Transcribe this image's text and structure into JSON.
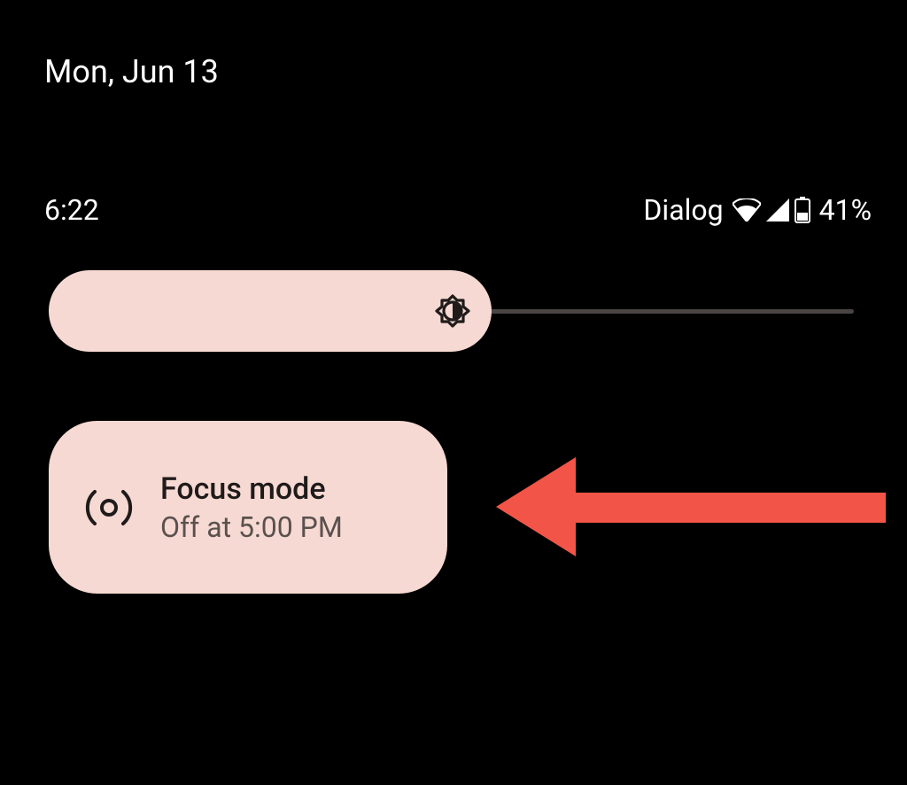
{
  "date": "Mon, Jun 13",
  "status": {
    "time": "6:22",
    "carrier": "Dialog",
    "battery_pct": "41%"
  },
  "brightness": {
    "value_pct": 55
  },
  "tile": {
    "title": "Focus mode",
    "subtitle": "Off at 5:00 PM"
  },
  "annotation": {
    "arrow_color": "#f25547"
  }
}
